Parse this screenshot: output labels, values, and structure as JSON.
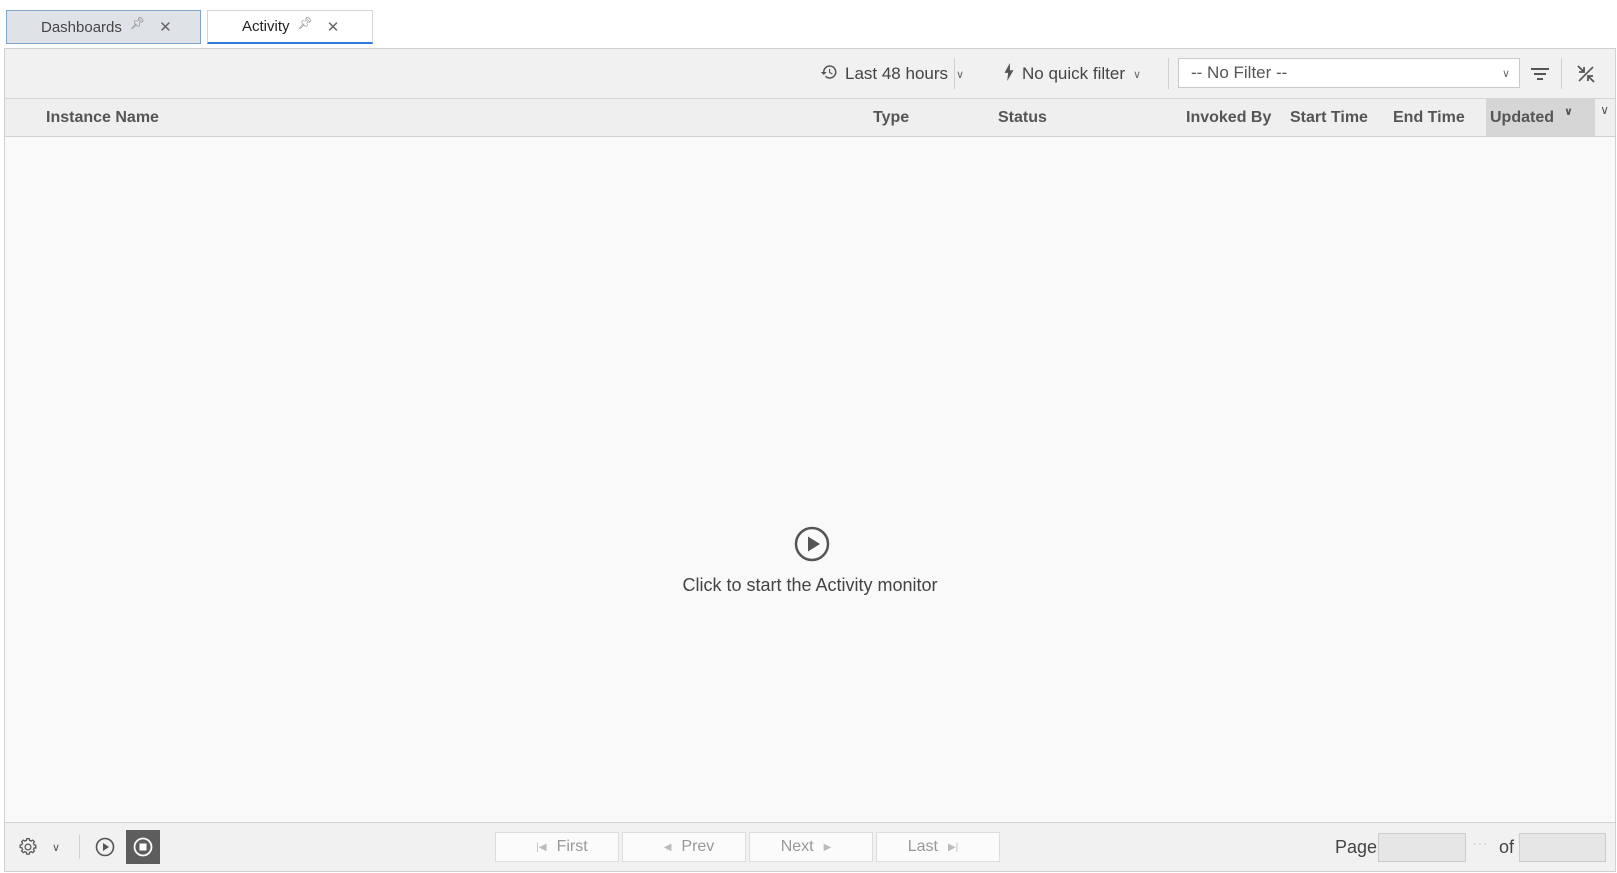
{
  "tabs": [
    {
      "label": "Dashboards",
      "active": false
    },
    {
      "label": "Activity",
      "active": true
    }
  ],
  "toolbar": {
    "time_range": "Last 48 hours",
    "quick_filter": "No quick filter",
    "filter_select": "-- No Filter --"
  },
  "table": {
    "columns": [
      "Instance Name",
      "Type",
      "Status",
      "Invoked By",
      "Start Time",
      "End Time",
      "Updated"
    ],
    "sorted_column": "Updated"
  },
  "empty_state": {
    "message": "Click to start the Activity monitor"
  },
  "pager": {
    "first": "First",
    "prev": "Prev",
    "next": "Next",
    "last": "Last",
    "page_label": "Page",
    "of_label": "of"
  },
  "icons": {
    "history": "history-icon",
    "bolt": "bolt-icon",
    "filter": "filter-lines-icon",
    "collapse": "collapse-icon",
    "gear": "gear-icon",
    "play": "play-circle-icon",
    "stop": "stop-circle-icon"
  }
}
